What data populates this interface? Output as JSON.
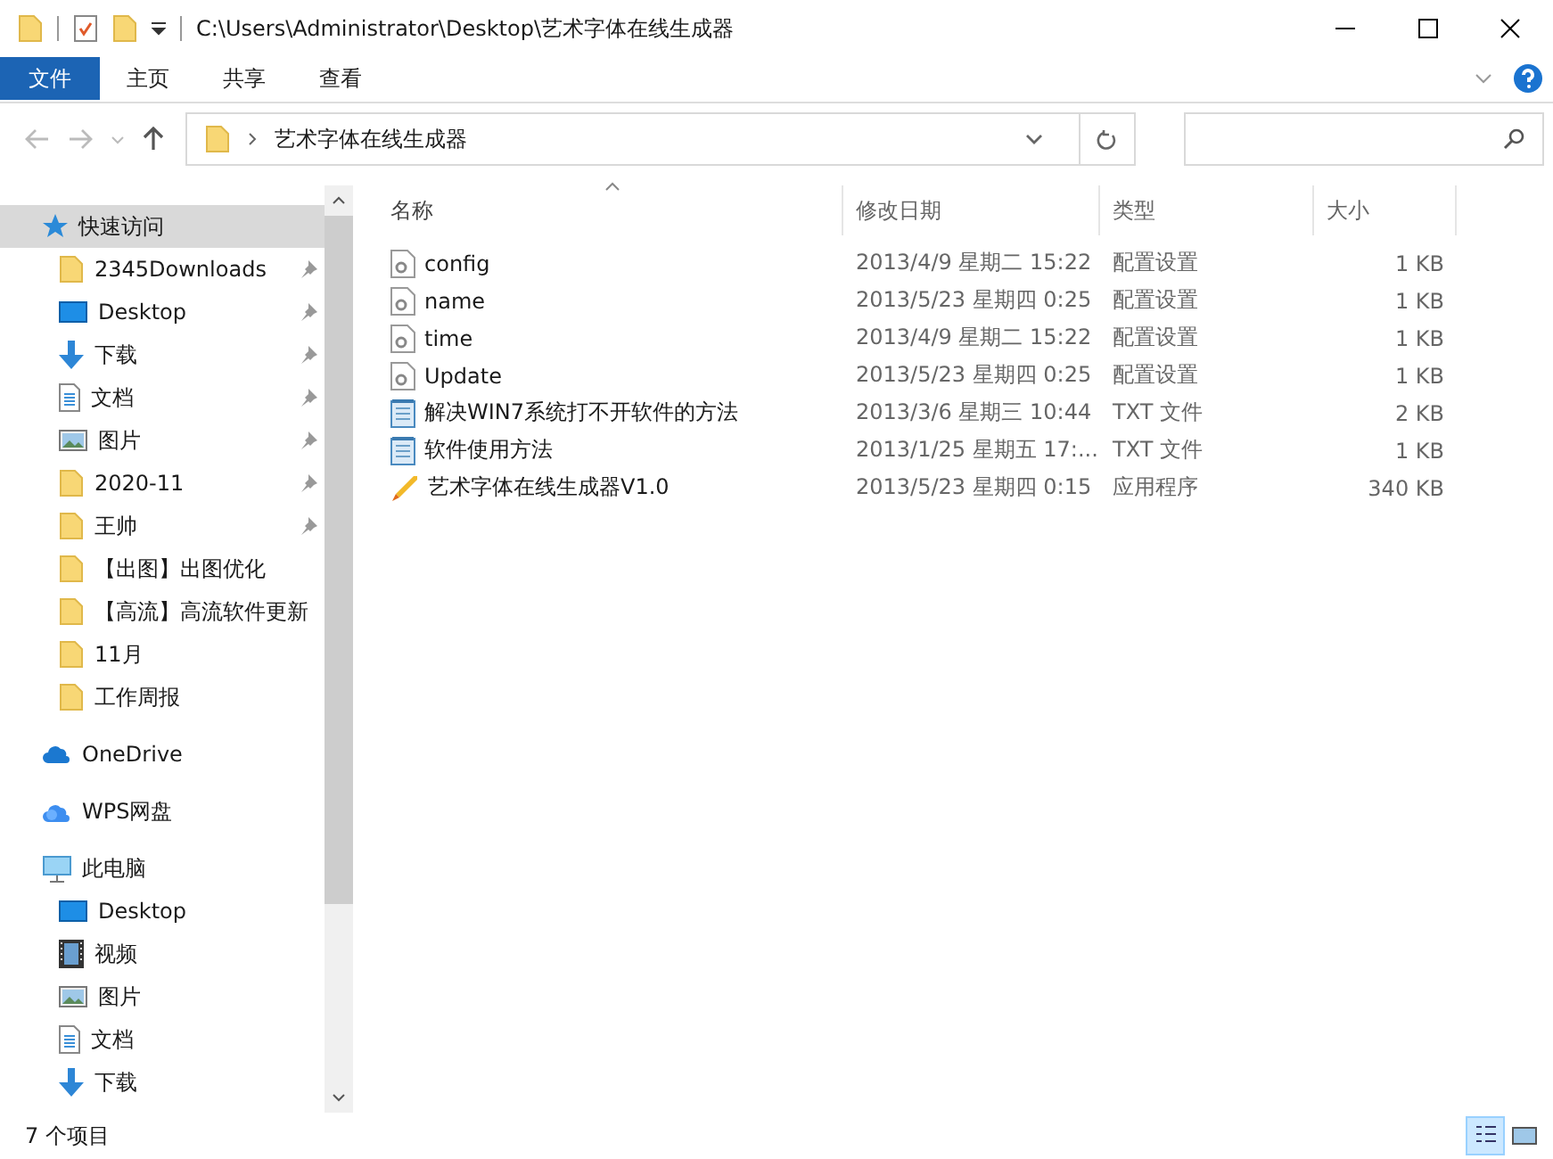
{
  "window": {
    "title": "C:\\Users\\Administrator\\Desktop\\艺术字体在线生成器"
  },
  "ribbon_tabs": [
    {
      "label": "文件",
      "selected": true
    },
    {
      "label": "主页",
      "selected": false
    },
    {
      "label": "共享",
      "selected": false
    },
    {
      "label": "查看",
      "selected": false
    }
  ],
  "address_bar": {
    "path": [
      "艺术字体在线生成器"
    ]
  },
  "sidebar": {
    "sections": [
      {
        "label": "快速访问",
        "kind": "quick",
        "selected": true,
        "children": [
          {
            "label": "2345Downloads",
            "kind": "folder",
            "pinned": true
          },
          {
            "label": "Desktop",
            "kind": "desktop",
            "pinned": true
          },
          {
            "label": "下载",
            "kind": "download",
            "pinned": true
          },
          {
            "label": "文档",
            "kind": "document",
            "pinned": true
          },
          {
            "label": "图片",
            "kind": "pictures",
            "pinned": true
          },
          {
            "label": "2020-11",
            "kind": "folder",
            "pinned": true
          },
          {
            "label": "王帅",
            "kind": "folder",
            "pinned": true
          },
          {
            "label": "【出图】出图优化",
            "kind": "folder",
            "pinned": false
          },
          {
            "label": "【高流】高流软件更新",
            "kind": "folder",
            "pinned": false
          },
          {
            "label": "11月",
            "kind": "folder",
            "pinned": false
          },
          {
            "label": "工作周报",
            "kind": "folder",
            "pinned": false
          }
        ]
      },
      {
        "label": "OneDrive",
        "kind": "cloud",
        "selected": false
      },
      {
        "label": "WPS网盘",
        "kind": "wps",
        "selected": false
      },
      {
        "label": "此电脑",
        "kind": "pc",
        "selected": false,
        "children": [
          {
            "label": "Desktop",
            "kind": "desktop",
            "pinned": false
          },
          {
            "label": "视频",
            "kind": "video",
            "pinned": false
          },
          {
            "label": "图片",
            "kind": "pictures",
            "pinned": false
          },
          {
            "label": "文档",
            "kind": "document",
            "pinned": false
          },
          {
            "label": "下载",
            "kind": "download",
            "pinned": false
          }
        ]
      }
    ]
  },
  "table": {
    "columns": [
      "名称",
      "修改日期",
      "类型",
      "大小"
    ],
    "rows": [
      {
        "name": "config",
        "kind": "settings",
        "modified": "2013/4/9 星期二 15:22",
        "type": "配置设置",
        "size": "1 KB"
      },
      {
        "name": "name",
        "kind": "settings",
        "modified": "2013/5/23 星期四 0:25",
        "type": "配置设置",
        "size": "1 KB"
      },
      {
        "name": "time",
        "kind": "settings",
        "modified": "2013/4/9 星期二 15:22",
        "type": "配置设置",
        "size": "1 KB"
      },
      {
        "name": "Update",
        "kind": "settings",
        "modified": "2013/5/23 星期四 0:25",
        "type": "配置设置",
        "size": "1 KB"
      },
      {
        "name": "解决WIN7系统打不开软件的方法",
        "kind": "text",
        "modified": "2013/3/6 星期三 10:44",
        "type": "TXT 文件",
        "size": "2 KB"
      },
      {
        "name": "软件使用方法",
        "kind": "text",
        "modified": "2013/1/25 星期五 17:...",
        "type": "TXT 文件",
        "size": "1 KB"
      },
      {
        "name": "艺术字体在线生成器V1.0",
        "kind": "app",
        "modified": "2013/5/23 星期四 0:15",
        "type": "应用程序",
        "size": "340 KB"
      }
    ]
  },
  "status_bar": {
    "count": "7 个项目",
    "views": [
      {
        "kind": "details",
        "selected": true
      },
      {
        "kind": "thumbnails",
        "selected": false
      }
    ]
  }
}
